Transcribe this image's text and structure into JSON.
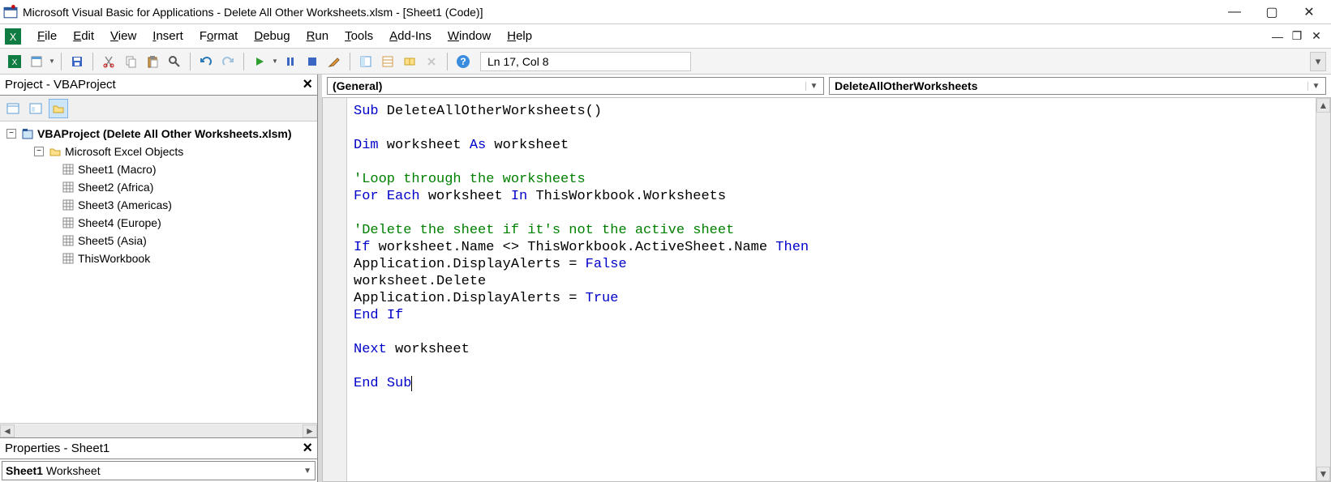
{
  "title": "Microsoft Visual Basic for Applications - Delete All Other Worksheets.xlsm - [Sheet1 (Code)]",
  "menus": {
    "file": {
      "label": "File",
      "ul": "F"
    },
    "edit": {
      "label": "Edit",
      "ul": "E"
    },
    "view": {
      "label": "View",
      "ul": "V"
    },
    "insert": {
      "label": "Insert",
      "ul": "I"
    },
    "format": {
      "label": "Format",
      "ul": "o"
    },
    "debug": {
      "label": "Debug",
      "ul": "D"
    },
    "run": {
      "label": "Run",
      "ul": "R"
    },
    "tools": {
      "label": "Tools",
      "ul": "T"
    },
    "addins": {
      "label": "Add-Ins",
      "ul": "A"
    },
    "window": {
      "label": "Window",
      "ul": "W"
    },
    "help": {
      "label": "Help",
      "ul": "H"
    }
  },
  "toolbar": {
    "status": "Ln 17, Col 8"
  },
  "project_panel": {
    "title": "Project - VBAProject",
    "root": "VBAProject (Delete All Other Worksheets.xlsm)",
    "folder": "Microsoft Excel Objects",
    "items": [
      "Sheet1 (Macro)",
      "Sheet2 (Africa)",
      "Sheet3 (Americas)",
      "Sheet4 (Europe)",
      "Sheet5 (Asia)",
      "ThisWorkbook"
    ]
  },
  "properties_panel": {
    "title": "Properties - Sheet1",
    "combo_name": "Sheet1",
    "combo_type": "Worksheet"
  },
  "code_dropdowns": {
    "left": "(General)",
    "right": "DeleteAllOtherWorksheets"
  },
  "code": {
    "tokens": [
      [
        {
          "t": "Sub",
          "c": "k"
        },
        {
          "t": " DeleteAllOtherWorksheets()"
        }
      ],
      [],
      [
        {
          "t": "Dim",
          "c": "k"
        },
        {
          "t": " worksheet "
        },
        {
          "t": "As",
          "c": "k"
        },
        {
          "t": " worksheet"
        }
      ],
      [],
      [
        {
          "t": "'Loop through the worksheets",
          "c": "c"
        }
      ],
      [
        {
          "t": "For",
          "c": "k"
        },
        {
          "t": " "
        },
        {
          "t": "Each",
          "c": "k"
        },
        {
          "t": " worksheet "
        },
        {
          "t": "In",
          "c": "k"
        },
        {
          "t": " ThisWorkbook.Worksheets"
        }
      ],
      [],
      [
        {
          "t": "'Delete the sheet if it's not the active sheet",
          "c": "c"
        }
      ],
      [
        {
          "t": "If",
          "c": "k"
        },
        {
          "t": " worksheet.Name <> ThisWorkbook.ActiveSheet.Name "
        },
        {
          "t": "Then",
          "c": "k"
        }
      ],
      [
        {
          "t": "Application.DisplayAlerts = "
        },
        {
          "t": "False",
          "c": "k"
        }
      ],
      [
        {
          "t": "worksheet.Delete"
        }
      ],
      [
        {
          "t": "Application.DisplayAlerts = "
        },
        {
          "t": "True",
          "c": "k"
        }
      ],
      [
        {
          "t": "End",
          "c": "k"
        },
        {
          "t": " "
        },
        {
          "t": "If",
          "c": "k"
        }
      ],
      [],
      [
        {
          "t": "Next",
          "c": "k"
        },
        {
          "t": " worksheet"
        }
      ],
      [],
      [
        {
          "t": "End",
          "c": "k"
        },
        {
          "t": " "
        },
        {
          "t": "Sub",
          "c": "k"
        }
      ]
    ]
  }
}
